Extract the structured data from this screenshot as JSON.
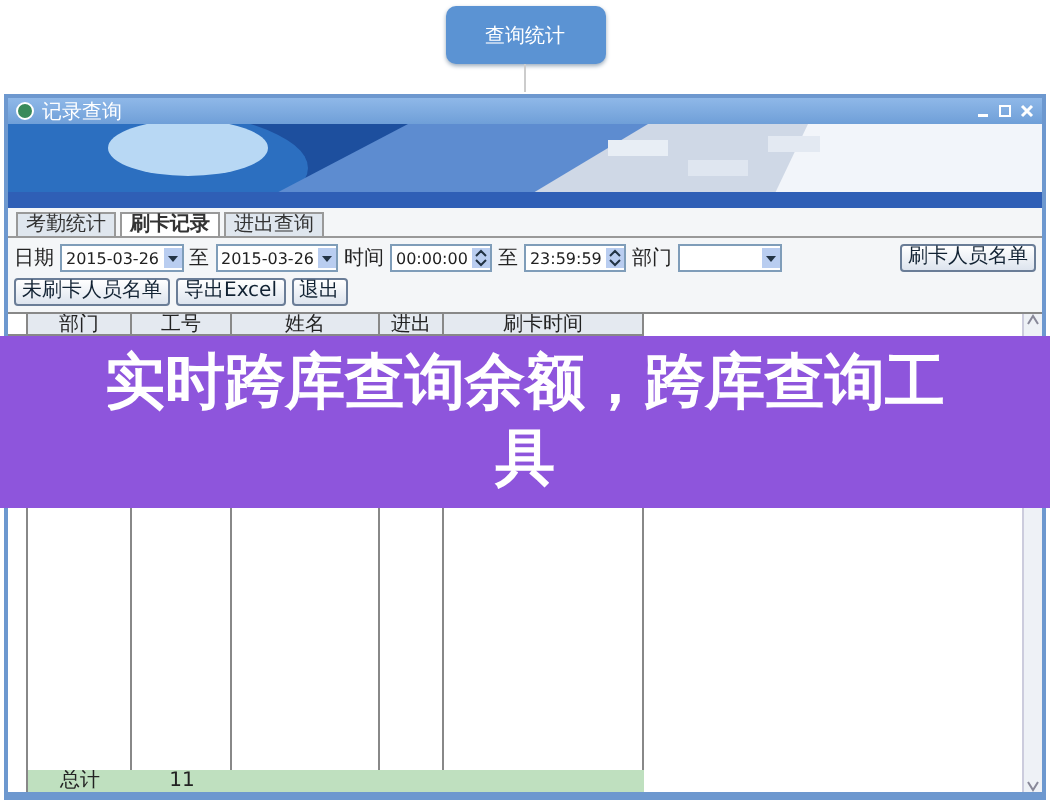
{
  "top_button": "查询统计",
  "window": {
    "title": "记录查询"
  },
  "tabs": [
    {
      "label": "考勤统计",
      "selected": false
    },
    {
      "label": "刷卡记录",
      "selected": true
    },
    {
      "label": "进出查询",
      "selected": false
    }
  ],
  "filters": {
    "date_label": "日期",
    "date_from": "2015-03-26",
    "to_1": "至",
    "date_to": "2015-03-26",
    "time_label": "时间",
    "time_from": "00:00:00",
    "to_2": "至",
    "time_to": "23:59:59",
    "dept_label": "部门"
  },
  "buttons": [
    "刷卡人员名单",
    "未刷卡人员名单",
    "导出Excel",
    "退出"
  ],
  "table": {
    "columns": [
      "部门",
      "工号",
      "姓名",
      "进出",
      "刷卡时间"
    ],
    "footer": [
      "总计",
      "11"
    ]
  },
  "banner": {
    "title": "实时跨库查询余额，跨库查询工具"
  }
}
